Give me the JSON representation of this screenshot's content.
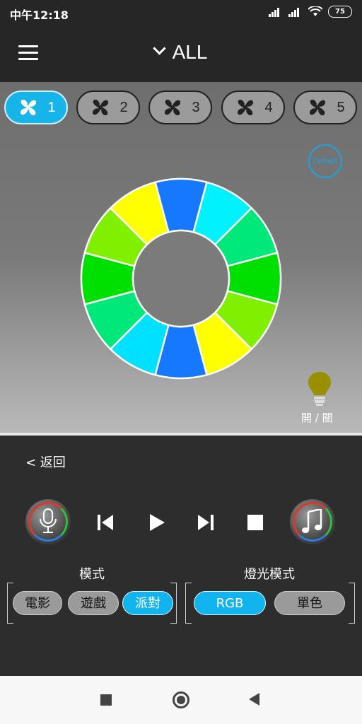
{
  "status": {
    "time": "中午12:18",
    "battery": "75"
  },
  "header": {
    "title": "ALL"
  },
  "fans": [
    {
      "label": "1",
      "active": true
    },
    {
      "label": "2",
      "active": false
    },
    {
      "label": "3",
      "active": false
    },
    {
      "label": "4",
      "active": false
    },
    {
      "label": "5",
      "active": false
    }
  ],
  "ring_colors": [
    "#1677ff",
    "#00f2ff",
    "#00e87a",
    "#00e000",
    "#80f000",
    "#ffff00",
    "#1677ff",
    "#00e0ff",
    "#00e87a",
    "#00e000",
    "#80f000",
    "#ffff00"
  ],
  "default_label": "Default",
  "light_toggle_label": "開 / 關",
  "panel": {
    "back_label": "< 返回",
    "mode_label": "模式",
    "light_mode_label": "燈光模式",
    "modes": [
      "電影",
      "遊戲",
      "派對"
    ],
    "active_mode": "派對",
    "light_modes": [
      "RGB",
      "單色"
    ],
    "active_light_mode": "RGB"
  },
  "accent_color": "#17b4ea"
}
